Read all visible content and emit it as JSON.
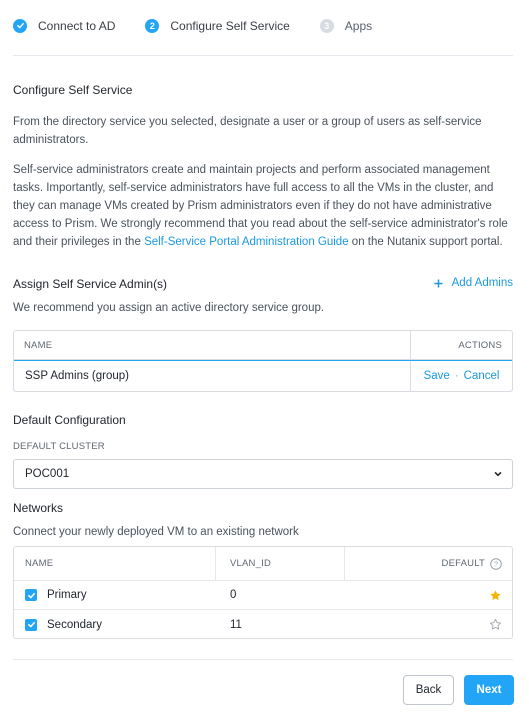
{
  "stepper": {
    "steps": [
      {
        "number": "",
        "label": "Connect to AD",
        "state": "done"
      },
      {
        "number": "2",
        "label": "Configure Self Service",
        "state": "active"
      },
      {
        "number": "3",
        "label": "Apps",
        "state": "pending"
      }
    ]
  },
  "configure": {
    "title": "Configure Self Service",
    "intro": "From the directory service you selected, designate a user or a group of users as self-service administrators.",
    "desc_part1": "Self-service administrators create and maintain projects and perform associated management tasks. Importantly, self-service administrators have full access to all the VMs in the cluster, and they can manage VMs created by Prism administrators even if they do not have administrative access to Prism. We strongly recommend that you read about the self-service administrator's role and their privileges in the ",
    "desc_link": "Self-Service Portal Administration Guide",
    "desc_part2": " on the Nutanix support portal."
  },
  "assign": {
    "title": "Assign Self Service Admin(s)",
    "add_label": "Add Admins",
    "hint": "We recommend you assign an active directory service group.",
    "table": {
      "col_name": "NAME",
      "col_actions": "ACTIONS",
      "row_value": "SSP Admins (group)",
      "save": "Save",
      "separator": "·",
      "cancel": "Cancel"
    }
  },
  "default_config": {
    "title": "Default Configuration",
    "cluster_label": "DEFAULT CLUSTER",
    "cluster_value": "POC001"
  },
  "networks": {
    "title": "Networks",
    "hint": "Connect your newly deployed VM to an existing network",
    "columns": {
      "name": "NAME",
      "vlan": "VLAN_ID",
      "default": "DEFAULT"
    },
    "rows": [
      {
        "name": "Primary",
        "vlan_id": "0",
        "checked": true,
        "default": true
      },
      {
        "name": "Secondary",
        "vlan_id": "11",
        "checked": true,
        "default": false
      }
    ]
  },
  "footer": {
    "back": "Back",
    "next": "Next"
  },
  "colors": {
    "accent": "#22a5f7",
    "star": "#f5b400"
  }
}
